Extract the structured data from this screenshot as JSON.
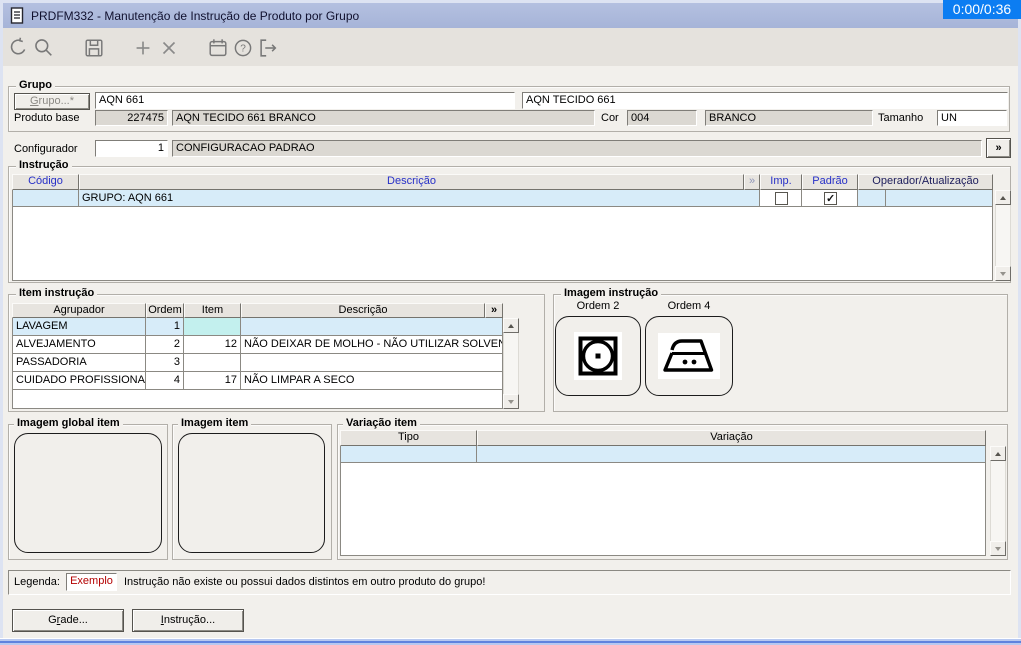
{
  "window": {
    "title": "PRDFM332 - Manutenção de Instrução de Produto por Grupo",
    "timer": "0:00/0:36"
  },
  "toolbar": {
    "help_glyph": "?"
  },
  "grupo": {
    "legend": "Grupo",
    "grupo_button": {
      "key": "G",
      "post": "rupo...*"
    },
    "grupo_code": "AQN 661",
    "grupo_desc": "AQN TECIDO 661",
    "produto_base_label": "Produto base",
    "produto_base_code": "227475",
    "produto_base_desc": "AQN TECIDO 661 BRANCO",
    "cor_label": "Cor",
    "cor_code": "004",
    "cor_desc": "BRANCO",
    "tamanho_label": "Tamanho",
    "tamanho_value": "UN"
  },
  "configurador": {
    "label": "Configurador",
    "code": "1",
    "desc": "CONFIGURACAO PADRAO",
    "expand_button": "»"
  },
  "instrucao": {
    "legend": "Instrução",
    "headers": {
      "codigo": "Código",
      "descricao": "Descrição",
      "mini": "»",
      "imp": "Imp.",
      "padrao": "Padrão",
      "operador": "Operador/Atualização"
    },
    "row": {
      "codigo": "",
      "descricao": "GRUPO: AQN 661",
      "imp_checked": false,
      "padrao_checked": true
    }
  },
  "item_instrucao": {
    "legend": "Item instrução",
    "headers": {
      "agrupador": "Agrupador",
      "ordem": "Ordem",
      "item": "Item",
      "descricao": "Descrição",
      "mini": "»"
    },
    "rows": [
      {
        "agrupador": "LAVAGEM",
        "ordem": "1",
        "item": "",
        "descricao": ""
      },
      {
        "agrupador": "ALVEJAMENTO",
        "ordem": "2",
        "item": "12",
        "descricao": "NÃO DEIXAR DE MOLHO - NÃO UTILIZAR SOLVENTES C"
      },
      {
        "agrupador": "PASSADORIA",
        "ordem": "3",
        "item": "",
        "descricao": ""
      },
      {
        "agrupador": "CUIDADO PROFISSIONAL",
        "ordem": "4",
        "item": "17",
        "descricao": "NÃO LIMPAR A SECO"
      }
    ]
  },
  "imagem_instrucao": {
    "legend": "Imagem instrução",
    "items": [
      {
        "label": "Ordem 2",
        "icon": "tumble-dry-icon"
      },
      {
        "label": "Ordem 4",
        "icon": "iron-two-dots-icon"
      }
    ]
  },
  "imagem_global_item": {
    "legend": "Imagem global item"
  },
  "imagem_item": {
    "legend": "Imagem item"
  },
  "variacao_item": {
    "legend": "Variação item",
    "headers": {
      "tipo": "Tipo",
      "variacao": "Variação"
    }
  },
  "legenda": {
    "label": "Legenda:",
    "exemplo": "Exemplo",
    "text": "Instrução não existe ou possui dados distintos em outro produto do grupo!"
  },
  "footer": {
    "grade": {
      "pre": "G",
      "key": "r",
      "post": "ade..."
    },
    "instrucao": {
      "key": "I",
      "post": "nstrução..."
    }
  },
  "colors": {
    "titlebar": "#a9b7d9",
    "timer_bg": "#0c7df2",
    "form_bg": "#f2f0ec",
    "header_link_blue": "#2730c8",
    "operador_navy": "#20205e",
    "row_highlight": "#d7ecf9",
    "selected_cell_cyan": "#c3f0ee",
    "legend_red": "#b40000",
    "readonly_field": "#dbd8d2"
  }
}
